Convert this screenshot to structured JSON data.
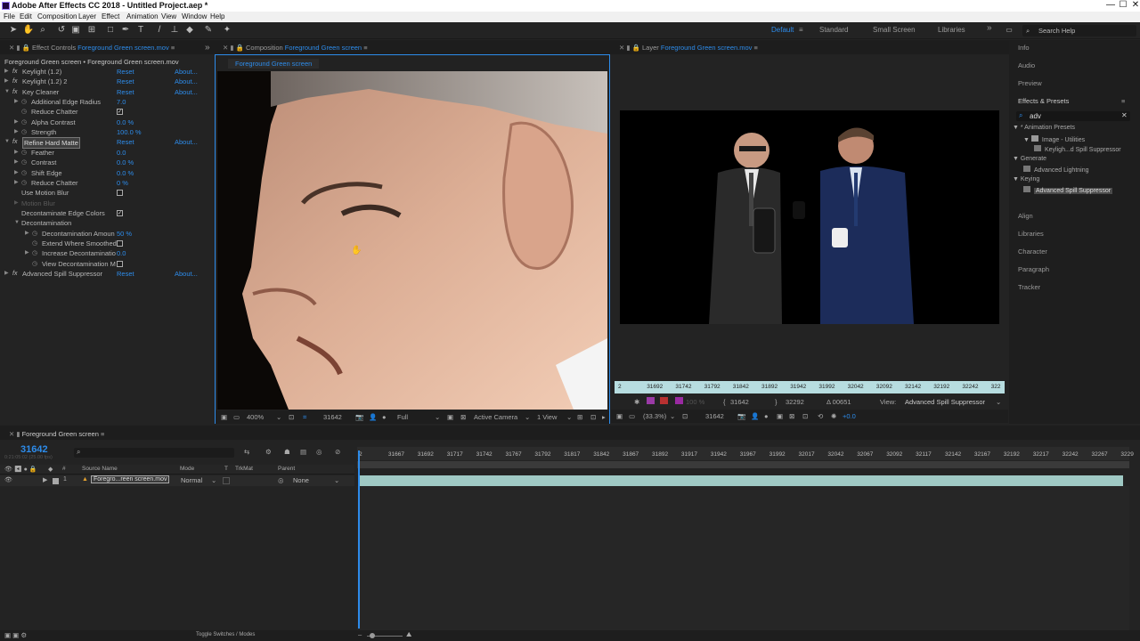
{
  "app": {
    "title": "Adobe After Effects CC 2018 - Untitled Project.aep *"
  },
  "window_controls": {
    "minimize": "—",
    "maximize": "☐",
    "close": "✕"
  },
  "menu": [
    "File",
    "Edit",
    "Composition",
    "Layer",
    "Effect",
    "Animation",
    "View",
    "Window",
    "Help"
  ],
  "workspaces": {
    "items": [
      "Default",
      "Standard",
      "Small Screen",
      "Libraries"
    ],
    "active": "Default",
    "more": "»"
  },
  "search_help": {
    "placeholder": "Search Help"
  },
  "effect_controls": {
    "tab_prefix": "Effect Controls",
    "tab_layer": "Foreground Green screen.mov",
    "header": "Foreground Green screen • Foreground Green screen.mov",
    "reset": "Reset",
    "about": "About...",
    "rows": [
      {
        "type": "fx",
        "label": "Keylight (1.2)",
        "reset": true,
        "about": true
      },
      {
        "type": "fx",
        "label": "Keylight (1.2) 2",
        "reset": true,
        "about": true
      },
      {
        "type": "fx",
        "label": "Key Cleaner",
        "open": true,
        "reset": true,
        "about": true
      },
      {
        "type": "param",
        "label": "Additional Edge Radius",
        "value": "7.0"
      },
      {
        "type": "param",
        "label": "Reduce Chatter",
        "checkbox": true,
        "checked": true,
        "notri": true
      },
      {
        "type": "param",
        "label": "Alpha Contrast",
        "value": "0.0 %"
      },
      {
        "type": "param",
        "label": "Strength",
        "value": "100.0 %"
      },
      {
        "type": "fx",
        "label": "Refine Hard Matte",
        "open": true,
        "reset": true,
        "about": true,
        "selected": true
      },
      {
        "type": "param",
        "label": "Feather",
        "value": "0.0"
      },
      {
        "type": "param",
        "label": "Contrast",
        "value": "0.0 %"
      },
      {
        "type": "param",
        "label": "Shift Edge",
        "value": "0.0 %"
      },
      {
        "type": "param",
        "label": "Reduce Chatter",
        "value": "0 %"
      },
      {
        "type": "plain",
        "label": "Use Motion Blur",
        "checkbox": true,
        "checked": false
      },
      {
        "type": "plain",
        "label": "Motion Blur",
        "dim": true,
        "tri": true
      },
      {
        "type": "plain",
        "label": "Decontaminate Edge Colors",
        "checkbox": true,
        "checked": true
      },
      {
        "type": "group",
        "label": "Decontamination",
        "open": true
      },
      {
        "type": "sub",
        "label": "Decontamination Amoun",
        "value": "50 %",
        "tri": true
      },
      {
        "type": "sub",
        "label": "Extend Where Smoothed",
        "checkbox": true,
        "checked": false
      },
      {
        "type": "sub",
        "label": "Increase Decontaminatio",
        "value": "0.0",
        "tri": true
      },
      {
        "type": "sub",
        "label": "View Decontamination M",
        "checkbox": true,
        "checked": false
      },
      {
        "type": "fx",
        "label": "Advanced Spill Suppressor",
        "reset": true,
        "about": true
      }
    ]
  },
  "composition": {
    "tab_prefix": "Composition",
    "tab_name": "Foreground Green screen",
    "breadcrumb": "Foreground Green screen",
    "footer": {
      "zoom": "400%",
      "timecode": "31642",
      "resolution": "Full",
      "camera": "Active Camera",
      "views": "1 View"
    }
  },
  "layer_panel": {
    "tab_prefix": "Layer",
    "tab_name": "Foreground Green screen.mov",
    "ruler": [
      "2",
      "31692",
      "31742",
      "31792",
      "31842",
      "31892",
      "31942",
      "31992",
      "32042",
      "32092",
      "32142",
      "32192",
      "32242",
      "322"
    ],
    "in_point": "31642",
    "out_point": "32292",
    "duration": "Δ 00651",
    "view_label": "View:",
    "view_value": "Advanced Spill Suppressor",
    "zoom": "(33.3%)",
    "timecode": "31642",
    "exposure": "+0.0",
    "opacity": "100 %"
  },
  "right_panels": {
    "items_top": [
      "Info",
      "Audio",
      "Preview"
    ],
    "effects_presets": "Effects & Presets",
    "search_value": "adv",
    "tree": [
      {
        "label": "* Animation Presets",
        "level": 0,
        "tri": "▼"
      },
      {
        "label": "Image - Utilities",
        "level": 1,
        "tri": "▼"
      },
      {
        "label": "Keyligh...d Spill Suppressor",
        "level": 2
      },
      {
        "label": "Generate",
        "level": 0,
        "tri": "▼"
      },
      {
        "label": "Advanced Lightning",
        "level": 1
      },
      {
        "label": "Keying",
        "level": 0,
        "tri": "▼"
      },
      {
        "label": "Advanced Spill Suppressor",
        "level": 1,
        "selected": true
      }
    ],
    "items_bottom": [
      "Align",
      "Libraries",
      "Character",
      "Paragraph",
      "Tracker"
    ]
  },
  "timeline": {
    "tab_name": "Foreground Green screen",
    "timecode": "31642",
    "timecode_sub": "0:21:05:02 (25.00 fps)",
    "columns": {
      "num": "#",
      "source": "Source Name",
      "mode": "Mode",
      "t": "T",
      "trkmat": "TrkMat",
      "parent": "Parent"
    },
    "layer": {
      "num": "1",
      "name": "Foregro...reen screen.mov",
      "mode": "Normal",
      "parent": "None"
    },
    "ruler": [
      "2",
      "31667",
      "31692",
      "31717",
      "31742",
      "31767",
      "31792",
      "31817",
      "31842",
      "31867",
      "31892",
      "31917",
      "31942",
      "31967",
      "31992",
      "32017",
      "32042",
      "32067",
      "32092",
      "32117",
      "32142",
      "32167",
      "32192",
      "32217",
      "32242",
      "32267",
      "3229"
    ],
    "toggle": "Toggle Switches / Modes"
  }
}
